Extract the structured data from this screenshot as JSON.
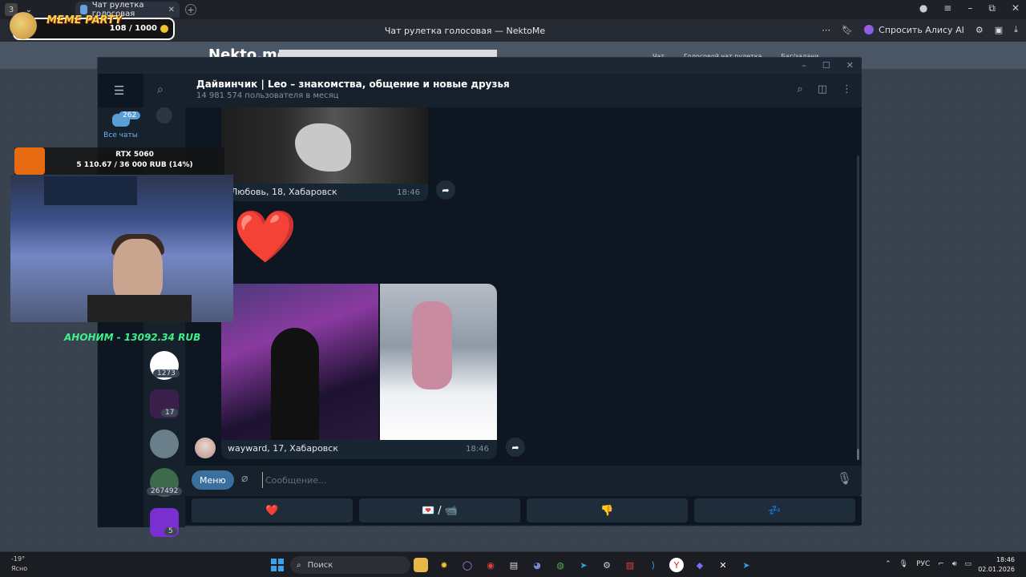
{
  "browser": {
    "tab_title": "Чат рулетка голосовая",
    "window_title": "Чат рулетка голосовая — NektoMe",
    "alice_label": "Спросить Алису AI"
  },
  "overlay": {
    "meme_label": "MEME PARTY",
    "meme_count": "108 / 1000",
    "rtx_title": "RTX 5060",
    "rtx_progress": "5 110.67 / 36 000 RUB (14%)",
    "donation": "АНОНИМ - 13092.34 RUB"
  },
  "nekto": {
    "logo": "Nekto.me",
    "nav": [
      "Чат",
      "Голосовой чат рулетка",
      "Баг/задачи"
    ]
  },
  "telegram": {
    "folder_all_label": "Все чаты",
    "folder_all_badge": "262",
    "chat_title": "Дайвинчик | Leo – знакомства, общение и новые друзья",
    "chat_subtitle": "14 981 574 пользователя в месяц",
    "chatlist_badges": [
      "1273",
      "17",
      "267492",
      "5"
    ],
    "messages": {
      "caption1": "Любовь, 18, Хабаровск",
      "time1": "18:46",
      "heart": "❤️",
      "caption2": "wayward, 17, Хабаровск",
      "time2": "18:46"
    },
    "composer": {
      "menu_label": "Меню",
      "placeholder": "Сообщение..."
    },
    "keyboard": [
      "❤️",
      "💌 / 📹",
      "👎",
      "💤"
    ]
  },
  "taskbar": {
    "weather_temp": "-19°",
    "weather_desc": "Ясно",
    "search_label": "Поиск",
    "lang": "РУС",
    "time": "18:46",
    "date": "02.01.2026"
  }
}
